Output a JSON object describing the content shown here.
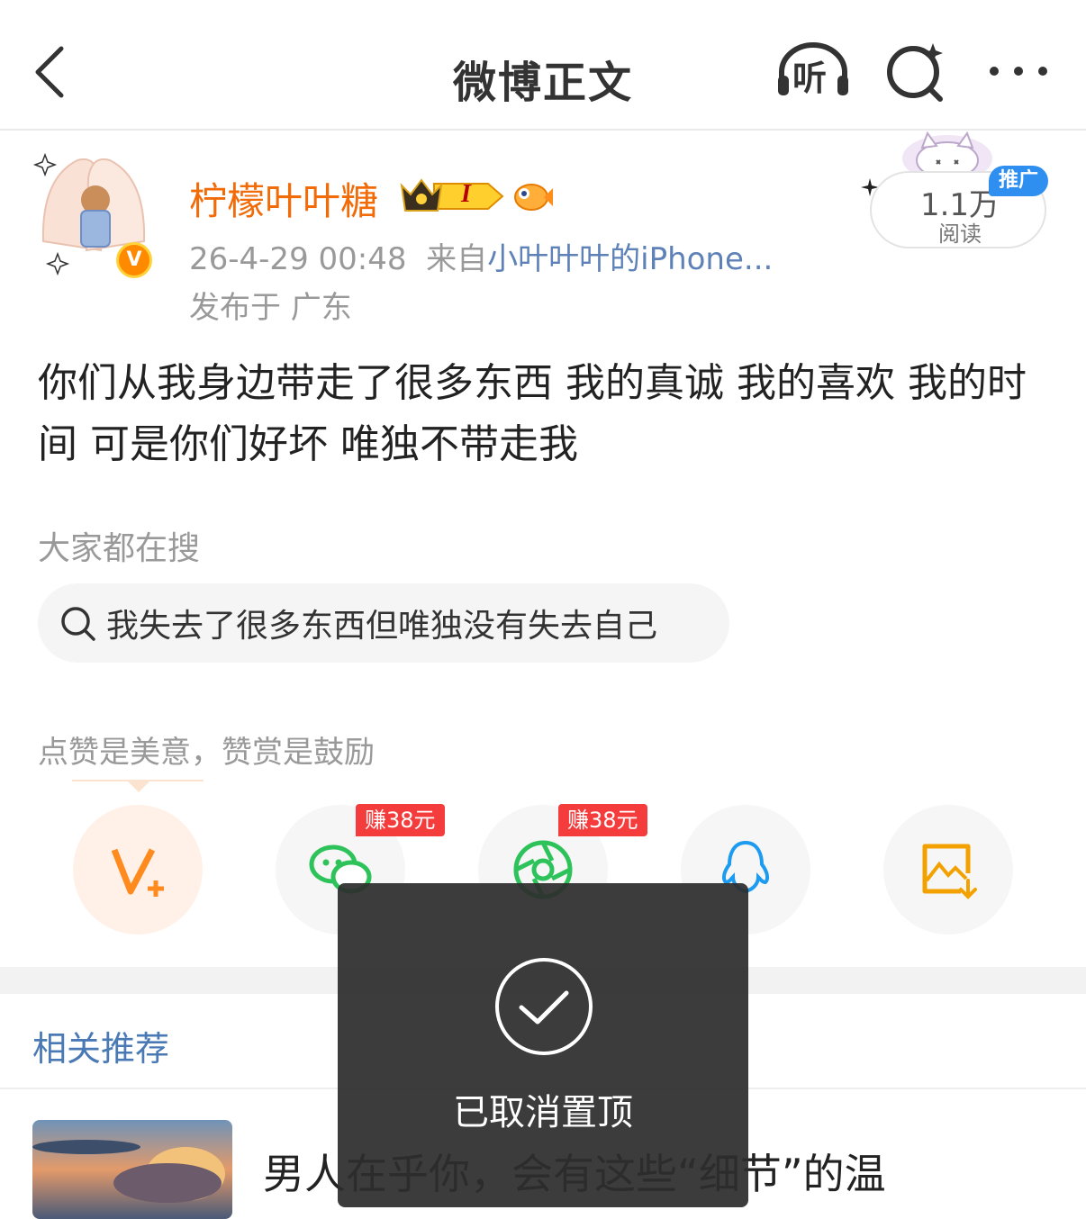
{
  "header": {
    "title": "微博正文",
    "listen_label": "听"
  },
  "post": {
    "author": {
      "name": "柠檬叶叶糖",
      "verified_badge": "V",
      "level_badge": "I"
    },
    "meta": {
      "time": "26-4-29 00:48",
      "from_prefix": "来自",
      "source": "小叶叶叶的iPhone..."
    },
    "location": "发布于 广东",
    "reads": {
      "count": "1.1万",
      "label": "阅读",
      "promo_badge": "推广"
    },
    "content": "你们从我身边带走了很多东西 我的真诚 我的喜欢 我的时间 可是你们好坏 唯独不带走我"
  },
  "search_section": {
    "label": "大家都在搜",
    "query": "我失去了很多东西但唯独没有失去自己"
  },
  "share": {
    "hint": "点赞是美意，赞赏是鼓励",
    "buttons": [
      {
        "icon": "v-plus-icon",
        "badge": ""
      },
      {
        "icon": "wechat-icon",
        "badge": "赚38元"
      },
      {
        "icon": "moments-icon",
        "badge": "赚38元"
      },
      {
        "icon": "qq-icon",
        "badge": ""
      },
      {
        "icon": "save-image-icon",
        "badge": ""
      }
    ]
  },
  "related": {
    "title": "相关推荐",
    "first_item_title": "男人在乎你，会有这些“细节”的温"
  },
  "toast": {
    "message": "已取消置顶"
  },
  "colors": {
    "username": "#f26b09",
    "source_link": "#5e81b8",
    "related_title": "#4a7ab5",
    "earn_badge": "#f53c3c",
    "promo_badge": "#2f8ff0"
  }
}
